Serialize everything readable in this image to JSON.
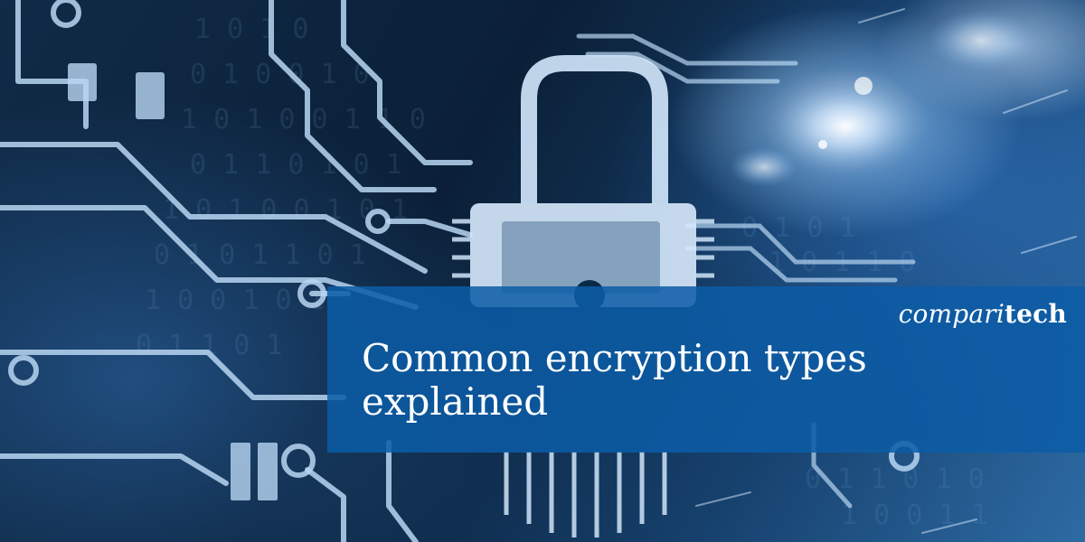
{
  "hero": {
    "brand": {
      "part1": "compari",
      "part2": "tech"
    },
    "headline": {
      "line1": "Common encryption types",
      "line2": "explained"
    }
  },
  "theme": {
    "banner_color": "#0c5ca6",
    "background_color": "#0b2038",
    "circuit_color": "#b8d6f2",
    "text_color": "#ffffff"
  },
  "icons": [
    "padlock-icon",
    "circuit-board-illustration",
    "light-flare"
  ]
}
